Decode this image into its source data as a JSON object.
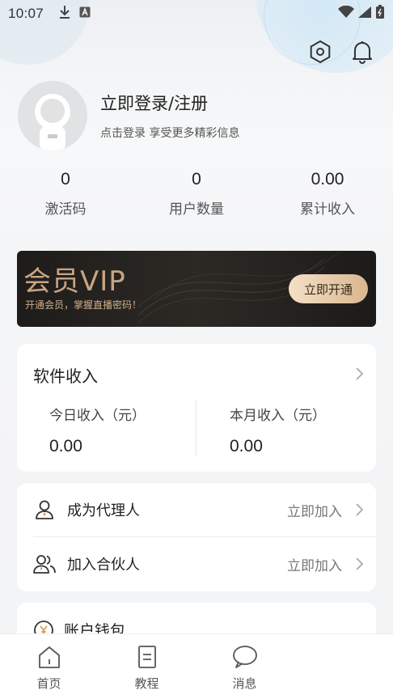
{
  "status_bar": {
    "time": "10:07"
  },
  "header": {
    "settings_icon": "hexagon-settings-icon",
    "notification_icon": "bell-icon"
  },
  "profile": {
    "title": "立即登录/注册",
    "subtitle": "点击登录 享受更多精彩信息"
  },
  "stats": [
    {
      "value": "0",
      "label": "激活码"
    },
    {
      "value": "0",
      "label": "用户数量"
    },
    {
      "value": "0.00",
      "label": "累计收入"
    }
  ],
  "vip": {
    "title": "会员VIP",
    "subtitle": "开通会员，掌握直播密码！",
    "button": "立即开通"
  },
  "income": {
    "title": "软件收入",
    "today_label": "今日收入（元）",
    "today_value": "0.00",
    "month_label": "本月收入（元）",
    "month_value": "0.00"
  },
  "join": [
    {
      "label": "成为代理人",
      "action": "立即加入"
    },
    {
      "label": "加入合伙人",
      "action": "立即加入"
    }
  ],
  "wallet": {
    "label": "账户钱包"
  },
  "bottom_nav": [
    {
      "label": "首页",
      "icon": "home-icon"
    },
    {
      "label": "教程",
      "icon": "document-icon"
    },
    {
      "label": "消息",
      "icon": "chat-icon"
    }
  ],
  "colors": {
    "vip_gold": "#c7a584",
    "vip_bg": "#1e1c1a",
    "card_bg": "#ffffff"
  }
}
